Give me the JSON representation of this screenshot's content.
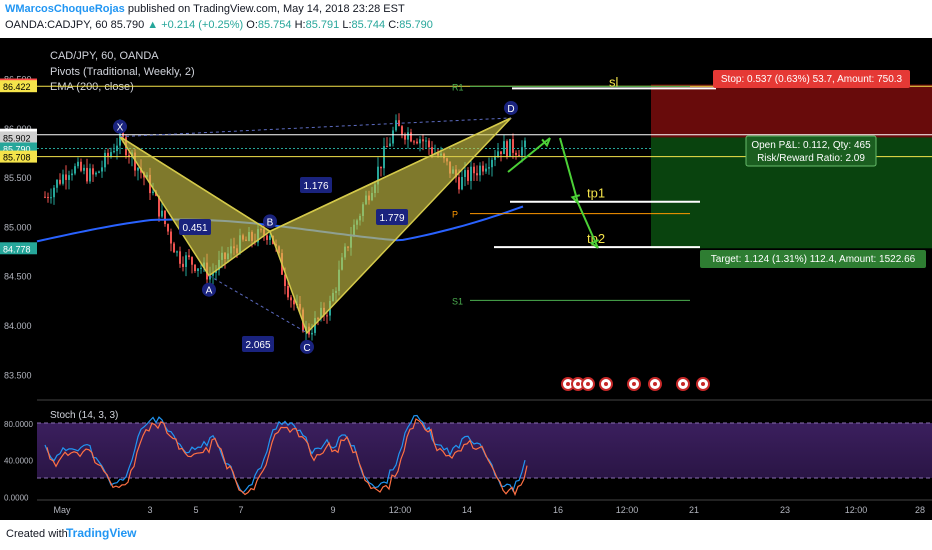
{
  "header": {
    "author": "WMarcosChoqueRojas",
    "published": " published on TradingView.com, May 14, 2018 23:28 EST",
    "symbol": "OANDA:CADJPY, 60",
    "price": "85.790",
    "change": "+0.214 (+0.25%)",
    "open_label": "O:",
    "open": "85.754",
    "high_label": "H:",
    "high": "85.791",
    "low_label": "L:",
    "low": "85.744",
    "close_label": "C:",
    "close": "85.790"
  },
  "legend": {
    "symbol": "CAD/JPY, 60, OANDA",
    "pivots": "Pivots (Traditional, Weekly, 2)",
    "ema": "EMA (200, close)",
    "stoch": "Stoch (14, 3, 3)"
  },
  "price_badges": [
    {
      "text": "86.439",
      "bg": "#ff4d4d",
      "fg": "#ffffff"
    },
    {
      "text": "86.422",
      "bg": "#f5e44b",
      "fg": "#000000"
    },
    {
      "text": "85.930",
      "bg": "#ffffff",
      "fg": "#000000"
    },
    {
      "text": "85.902",
      "bg": "#d0d0d0",
      "fg": "#000000"
    },
    {
      "text": "85.790",
      "bg": "#26a69a",
      "fg": "#ffffff"
    },
    {
      "text": "85.708",
      "bg": "#f5e44b",
      "fg": "#000000"
    },
    {
      "text": "84.778",
      "bg": "#26a69a",
      "fg": "#ffffff"
    }
  ],
  "position": {
    "stop_text": "Stop: 0.537 (0.63%) 53.7, Amount: 750.3",
    "pnl_text": "Open P&L: 0.112, Qty: 465",
    "rr_text": "Risk/Reward Ratio: 2.09",
    "target_text": "Target: 1.124 (1.31%) 112.4, Amount: 1522.66"
  },
  "pattern": {
    "points": [
      "X",
      "A",
      "B",
      "C",
      "D"
    ],
    "ratios": [
      "0.451",
      "2.065",
      "1.176",
      "1.779"
    ]
  },
  "levels": {
    "sl": "sl",
    "tp1": "tp1",
    "tp2": "tp2",
    "R1": "R1",
    "P": "P",
    "S1": "S1"
  },
  "footer": {
    "created": "Created with",
    "brand": "TradingView"
  },
  "chart_data": {
    "type": "candlestick",
    "ylim": [
      83.3,
      86.85
    ],
    "yticks": [
      "86.500",
      "86.000",
      "85.500",
      "85.000",
      "84.500",
      "84.000",
      "83.500"
    ],
    "xticks": [
      "May",
      "3",
      "5",
      "7",
      "9",
      "12:00",
      "14",
      "16",
      "12:00",
      "21",
      "23",
      "12:00",
      "28"
    ],
    "harmonic": {
      "X": 85.91,
      "A": 84.5,
      "B": 84.95,
      "C": 83.92,
      "D": 86.1
    },
    "levels": {
      "stop": 86.439,
      "entry": 85.902,
      "target": 84.778,
      "tp1": 85.25,
      "tp2": 84.79,
      "sl": 86.4
    },
    "pivots": {
      "R1": 86.42,
      "P": 85.13,
      "S1": 84.25
    },
    "stoch_yticks": [
      "80.0000",
      "40.0000",
      "0.0000"
    ],
    "stoch_ylim": [
      0,
      100
    ],
    "stoch_bands": [
      80,
      20
    ]
  }
}
